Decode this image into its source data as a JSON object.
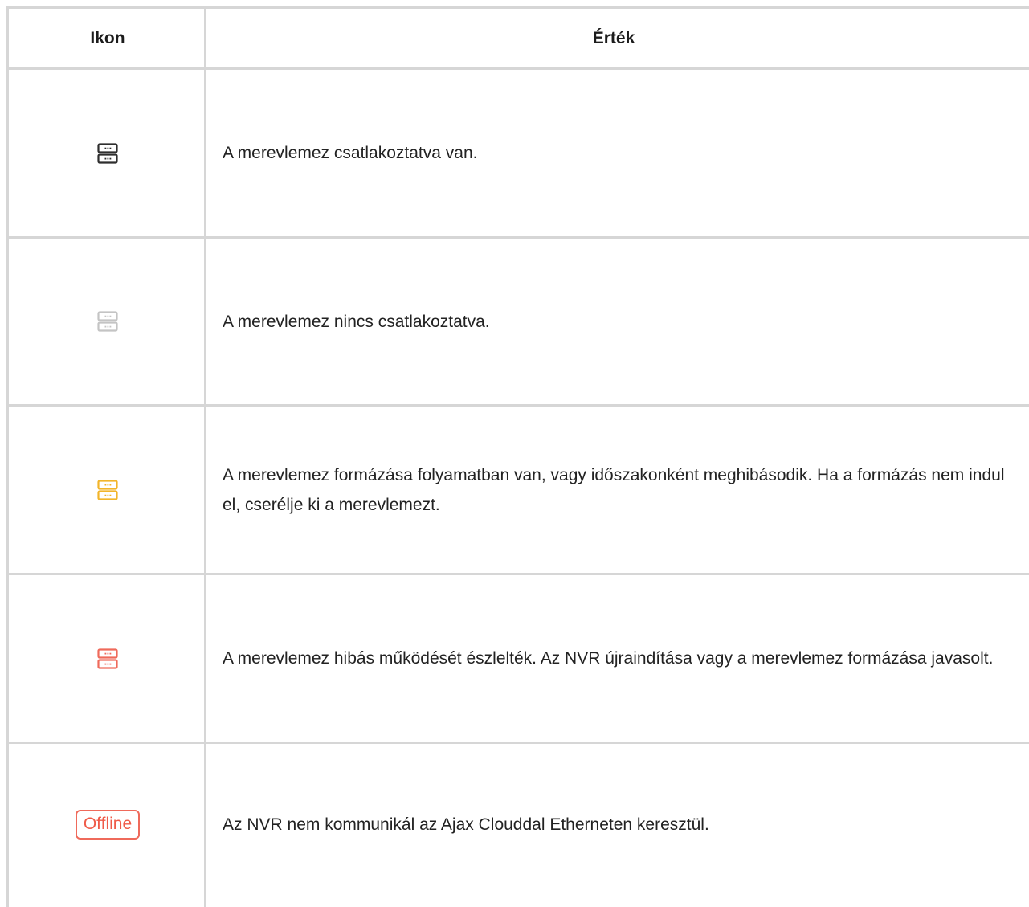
{
  "header": {
    "icon_col": "Ikon",
    "value_col": "Érték"
  },
  "rows": [
    {
      "icon": "hdd-icon",
      "icon_color": "#2e2e2e",
      "text": "A merevlemez csatlakoztatva van."
    },
    {
      "icon": "hdd-icon",
      "icon_color": "#c4c4c4",
      "text": "A merevlemez nincs csatlakoztatva."
    },
    {
      "icon": "hdd-icon",
      "icon_color": "#f2b52a",
      "text": "A merevlemez formázása folyamatban van, vagy időszakonként meghibásodik. Ha a formázás nem indul el, cserélje ki a merevlemezt."
    },
    {
      "icon": "hdd-icon",
      "icon_color": "#ef6a5b",
      "text": "A merevlemez hibás működését észlelték. Az NVR újraindítása vagy a merevlemez formázása javasolt."
    },
    {
      "icon": "offline-badge",
      "icon_color": "#ef6a5b",
      "badge_label": "Offline",
      "text": "Az NVR nem kommunikál az Ajax Clouddal Etherneten keresztül."
    }
  ]
}
